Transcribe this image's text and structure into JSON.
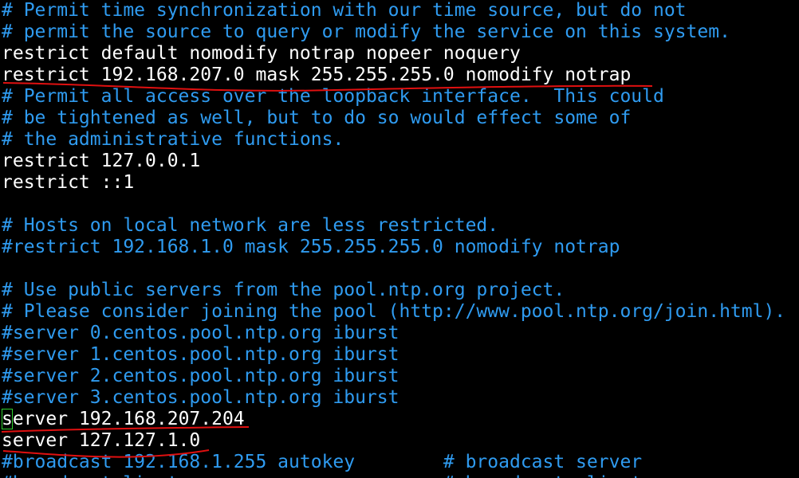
{
  "editor": {
    "colors": {
      "background": "#000000",
      "comment": "#2f9bf0",
      "code": "#ffffff",
      "cursor": "#2fd02f",
      "annotation": "#e01010"
    },
    "lines": [
      {
        "text": "# Permit time synchronization with our time source, but do not",
        "kind": "comment"
      },
      {
        "text": "# permit the source to query or modify the service on this system.",
        "kind": "comment"
      },
      {
        "text": "restrict default nomodify notrap nopeer noquery",
        "kind": "code"
      },
      {
        "text": "restrict 192.168.207.0 mask 255.255.255.0 nomodify notrap",
        "kind": "code"
      },
      {
        "text": "# Permit all access over the loopback interface.  This could",
        "kind": "comment"
      },
      {
        "text": "# be tightened as well, but to do so would effect some of",
        "kind": "comment"
      },
      {
        "text": "# the administrative functions.",
        "kind": "comment"
      },
      {
        "text": "restrict 127.0.0.1",
        "kind": "code"
      },
      {
        "text": "restrict ::1",
        "kind": "code"
      },
      {
        "text": "",
        "kind": "blank"
      },
      {
        "text": "# Hosts on local network are less restricted.",
        "kind": "comment"
      },
      {
        "text": "#restrict 192.168.1.0 mask 255.255.255.0 nomodify notrap",
        "kind": "comment"
      },
      {
        "text": "",
        "kind": "blank"
      },
      {
        "text": "# Use public servers from the pool.ntp.org project.",
        "kind": "comment"
      },
      {
        "text": "# Please consider joining the pool (http://www.pool.ntp.org/join.html).",
        "kind": "comment"
      },
      {
        "text": "#server 0.centos.pool.ntp.org iburst",
        "kind": "comment"
      },
      {
        "text": "#server 1.centos.pool.ntp.org iburst",
        "kind": "comment"
      },
      {
        "text": "#server 2.centos.pool.ntp.org iburst",
        "kind": "comment"
      },
      {
        "text": "#server 3.centos.pool.ntp.org iburst",
        "kind": "comment"
      },
      {
        "text": "server 192.168.207.204",
        "kind": "code",
        "cursor": true
      },
      {
        "text": "server 127.127.1.0",
        "kind": "code"
      },
      {
        "text": "#broadcast 192.168.1.255 autokey        # broadcast server",
        "kind": "comment"
      },
      {
        "text": "#broadcastclient                        # broadcast client",
        "kind": "comment"
      }
    ]
  }
}
